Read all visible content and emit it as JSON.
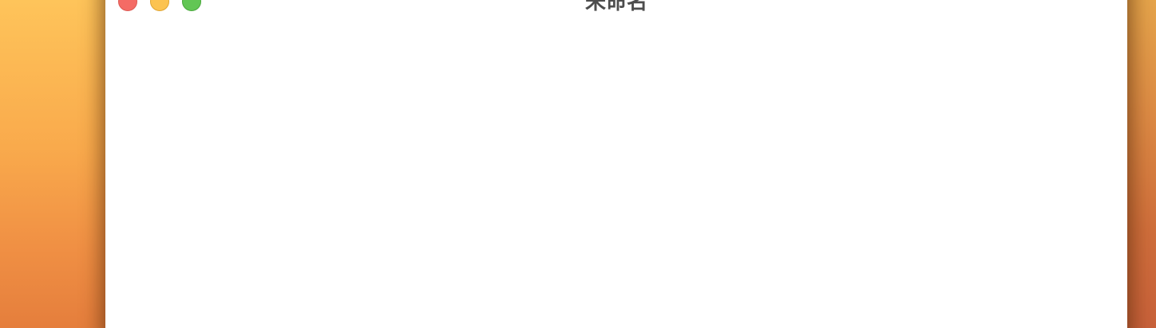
{
  "window": {
    "title": "未命名",
    "controls": {
      "close_icon": "close-icon",
      "minimize_icon": "minimize-icon",
      "zoom_icon": "zoom-icon"
    }
  },
  "colors": {
    "close": "#f46b65",
    "minimize": "#fcc350",
    "zoom": "#62c654",
    "title_text": "#4d4d4d",
    "window_bg": "#ffffff"
  }
}
